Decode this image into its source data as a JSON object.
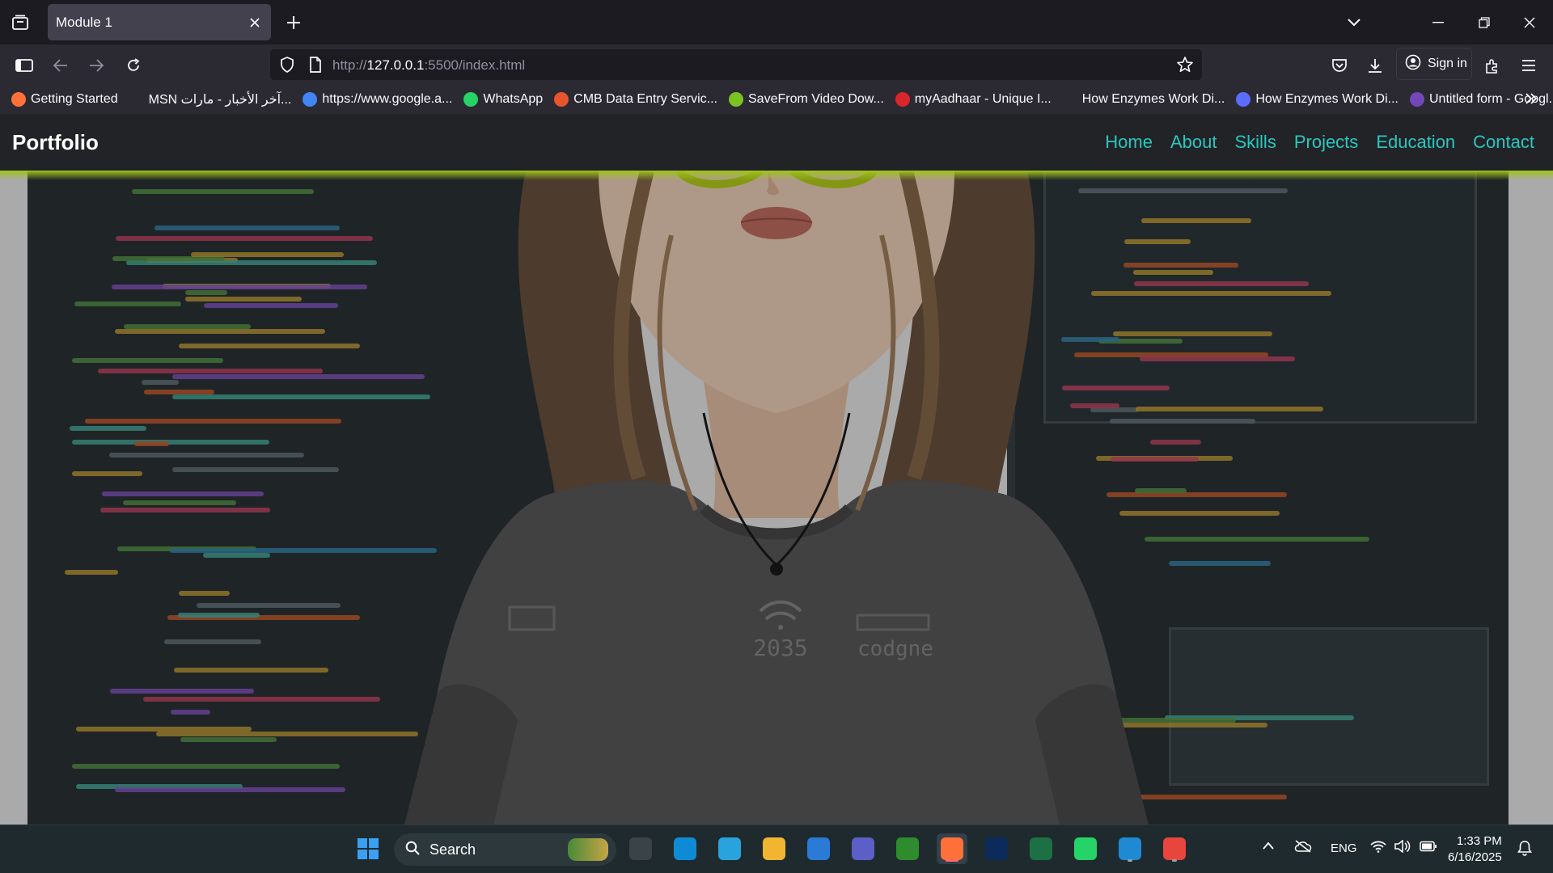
{
  "browser": {
    "tab": {
      "title": "Module 1"
    },
    "url": {
      "prefix": "http://",
      "host": "127.0.0.1",
      "rest": ":5500/index.html"
    },
    "signin_label": "Sign in",
    "bookmarks": [
      {
        "label": "Getting Started",
        "icon": "firefox-icon",
        "color": "#ff7139"
      },
      {
        "label": "MSN آخر الأخبار - مارات...",
        "icon": "msn-icon",
        "color": "#2b2a33"
      },
      {
        "label": "https://www.google.a...",
        "icon": "google-icon",
        "color": "#4285f4"
      },
      {
        "label": "WhatsApp",
        "icon": "whatsapp-icon",
        "color": "#25d366"
      },
      {
        "label": "CMB Data Entry Servic...",
        "icon": "cmb-icon",
        "color": "#e8542c"
      },
      {
        "label": "SaveFrom Video Dow...",
        "icon": "savefrom-icon",
        "color": "#7bc224"
      },
      {
        "label": "myAadhaar - Unique I...",
        "icon": "aadhaar-icon",
        "color": "#d9262b"
      },
      {
        "label": "How Enzymes Work Di...",
        "icon": "globe-icon",
        "color": "#2b2a33"
      },
      {
        "label": "How Enzymes Work Di...",
        "icon": "shield-blue-icon",
        "color": "#5b6cff"
      },
      {
        "label": "Untitled form - Googl...",
        "icon": "forms-icon",
        "color": "#7248b9"
      }
    ]
  },
  "site": {
    "logo": "Portfolio",
    "nav": [
      "Home",
      "About",
      "Skills",
      "Projects",
      "Education",
      "Contact"
    ],
    "shirt_text": {
      "left": "2035",
      "right": "codgne"
    }
  },
  "taskbar": {
    "search_label": "Search",
    "apps": [
      {
        "name": "task-view-icon",
        "color": "#3a4448"
      },
      {
        "name": "edge-icon",
        "color": "#0f8bd6"
      },
      {
        "name": "telegram-icon",
        "color": "#2aa3dd"
      },
      {
        "name": "file-explorer-icon",
        "color": "#f2b531"
      },
      {
        "name": "store-icon",
        "color": "#2a7ad6"
      },
      {
        "name": "teams-icon",
        "color": "#5b5fc7"
      },
      {
        "name": "vim-icon",
        "color": "#2e8b2e"
      },
      {
        "name": "firefox-icon",
        "color": "#ff7139"
      },
      {
        "name": "photoshop-icon",
        "color": "#0c2b5a"
      },
      {
        "name": "excel-icon",
        "color": "#1d7044"
      },
      {
        "name": "whatsapp-icon",
        "color": "#25d366"
      },
      {
        "name": "vscode-icon",
        "color": "#1f8ad2"
      },
      {
        "name": "chrome-icon",
        "color": "#e8453c"
      }
    ],
    "tray": {
      "language": "ENG",
      "time": "1:33 PM",
      "date": "6/16/2025"
    }
  },
  "colors": {
    "nav_link": "#2ac7c2",
    "header_bg": "#222326",
    "accent_glow": "#9fc41c"
  }
}
